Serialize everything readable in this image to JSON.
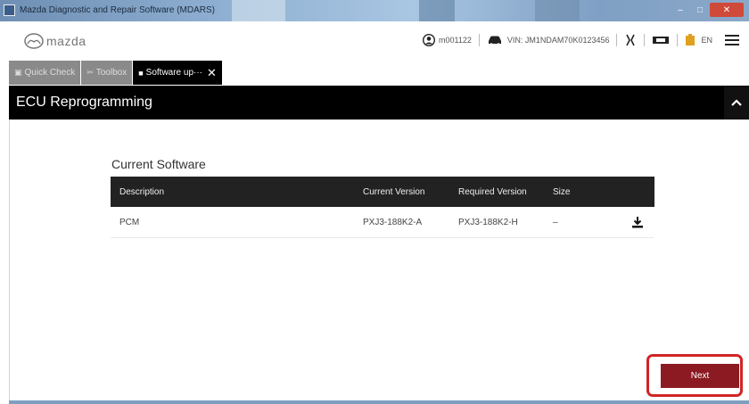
{
  "window": {
    "title": "Mazda Diagnostic and Repair Software (MDARS)",
    "controls": {
      "minimize": "–",
      "maximize": "□",
      "close": "✕"
    }
  },
  "header": {
    "logo_text": "mazda",
    "user_id": "m001122",
    "vin_text": "VIN: JM1NDAM70K0123456",
    "lang": "EN"
  },
  "tabs": [
    {
      "label": "Quick Check",
      "icon": "car-icon"
    },
    {
      "label": "Toolbox",
      "icon": "tools-icon"
    },
    {
      "label": "Software up···",
      "icon": "chip-icon",
      "close": "✕",
      "active": true
    }
  ],
  "section": {
    "title": "ECU Reprogramming"
  },
  "current_software": {
    "title": "Current Software",
    "columns": [
      "Description",
      "Current Version",
      "Required Version",
      "Size"
    ],
    "rows": [
      {
        "description": "PCM",
        "current_version": "PXJ3-188K2-A",
        "required_version": "PXJ3-188K2-H",
        "size": "–"
      }
    ]
  },
  "actions": {
    "next_label": "Next"
  },
  "colors": {
    "accent": "#8b1a22",
    "highlight": "#d12525",
    "bar": "#000000",
    "tab_inactive": "#8a8a8a"
  }
}
